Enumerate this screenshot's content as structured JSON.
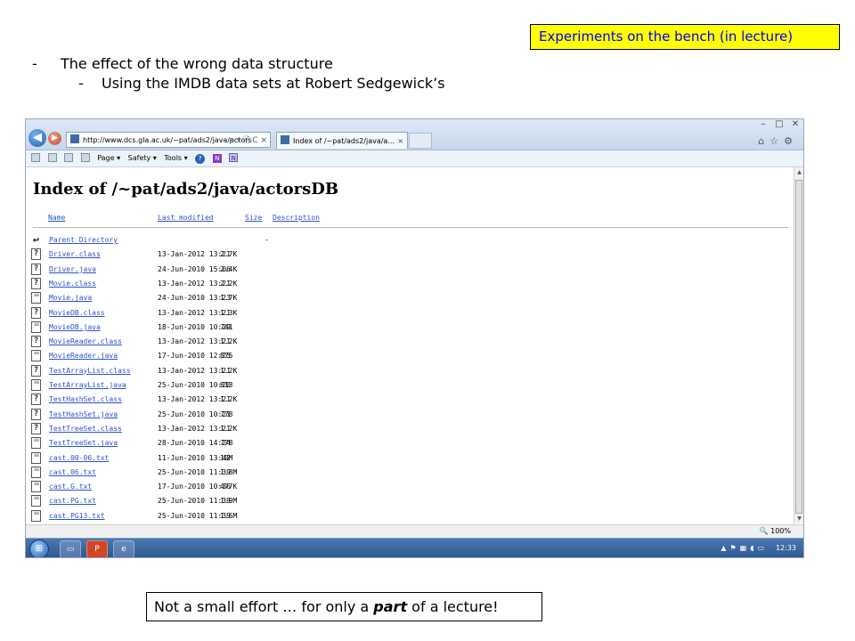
{
  "slide": {
    "callout_top": "Experiments on the bench (in lecture)",
    "bullets": [
      {
        "marker": "-",
        "text": "The effect of the wrong data structure"
      },
      {
        "marker": "-",
        "text": "Using the IMDB data sets at Robert Sedgewick’s"
      }
    ],
    "callout_bottom": {
      "before": "Not a small effort … for only a ",
      "emph": "part",
      "after": " of a lecture!"
    }
  },
  "browser": {
    "address": "http://www.dcs.gla.ac.uk/~pat/ads2/java/actors",
    "address_tools": "ρ ▾ 🗎 C ×",
    "tab_title": "Index of /~pat/ads2/java/a...",
    "command_bar": {
      "page": "Page ▾",
      "safety": "Safety ▾",
      "tools": "Tools ▾"
    },
    "zoom": "🔍 100%",
    "clock": "12:33"
  },
  "listing": {
    "heading": "Index of /~pat/ads2/java/actorsDB",
    "columns": {
      "name": "Name",
      "modified": "Last modified",
      "size": "Size",
      "description": "Description"
    },
    "rows": [
      {
        "icon": "back",
        "name": "Parent Directory",
        "date": "",
        "size": "-"
      },
      {
        "icon": "unknown",
        "name": "Driver.class",
        "date": "13-Jan-2012 13:21",
        "size": "2.7K"
      },
      {
        "icon": "unknown",
        "name": "Driver.java",
        "date": "24-Jun-2010 15:06",
        "size": "2.4K"
      },
      {
        "icon": "unknown",
        "name": "Movie.class",
        "date": "13-Jan-2012 13:21",
        "size": "2.2K"
      },
      {
        "icon": "text",
        "name": "Movie.java",
        "date": "24-Jun-2010 13:23",
        "size": "1.7K"
      },
      {
        "icon": "unknown",
        "name": "MovieDB.class",
        "date": "13-Jan-2012 13:21",
        "size": "1.3K"
      },
      {
        "icon": "text",
        "name": "MovieDB.java",
        "date": "18-Jun-2010 10:29",
        "size": "741"
      },
      {
        "icon": "unknown",
        "name": "MovieReader.class",
        "date": "13-Jan-2012 13:21",
        "size": "1.2K"
      },
      {
        "icon": "text",
        "name": "MovieReader.java",
        "date": "17-Jun-2010 12:25",
        "size": "875"
      },
      {
        "icon": "unknown",
        "name": "TestArrayList.class",
        "date": "13-Jan-2012 13:21",
        "size": "1.2K"
      },
      {
        "icon": "text",
        "name": "TestArrayList.java",
        "date": "25-Jun-2010 10:20",
        "size": "813"
      },
      {
        "icon": "unknown",
        "name": "TestHashSet.class",
        "date": "13-Jan-2012 13:21",
        "size": "1.2K"
      },
      {
        "icon": "unknown",
        "name": "TestHashSet.java",
        "date": "25-Jun-2010 10:21",
        "size": "778"
      },
      {
        "icon": "unknown",
        "name": "TestTreeSet.class",
        "date": "13-Jan-2012 13:21",
        "size": "1.2K"
      },
      {
        "icon": "text",
        "name": "TestTreeSet.java",
        "date": "28-Jun-2010 14:24",
        "size": "778"
      },
      {
        "icon": "text",
        "name": "cast.00-06.txt",
        "date": "11-Jun-2010 13:42",
        "size": "10M"
      },
      {
        "icon": "text",
        "name": "cast.06.txt",
        "date": "25-Jun-2010 11:39",
        "size": "1.8M"
      },
      {
        "icon": "text",
        "name": "cast.G.txt",
        "date": "17-Jun-2010 10:36",
        "size": "477K"
      },
      {
        "icon": "text",
        "name": "cast.PG.txt",
        "date": "25-Jun-2010 11:39",
        "size": "1.9M"
      },
      {
        "icon": "text",
        "name": "cast.PG13.txt",
        "date": "25-Jun-2010 11:39",
        "size": "1.6M"
      }
    ]
  },
  "colors": {
    "callout_bg": "#ffff00",
    "callout_text": "#0000ff",
    "link": "#2b55c9"
  }
}
